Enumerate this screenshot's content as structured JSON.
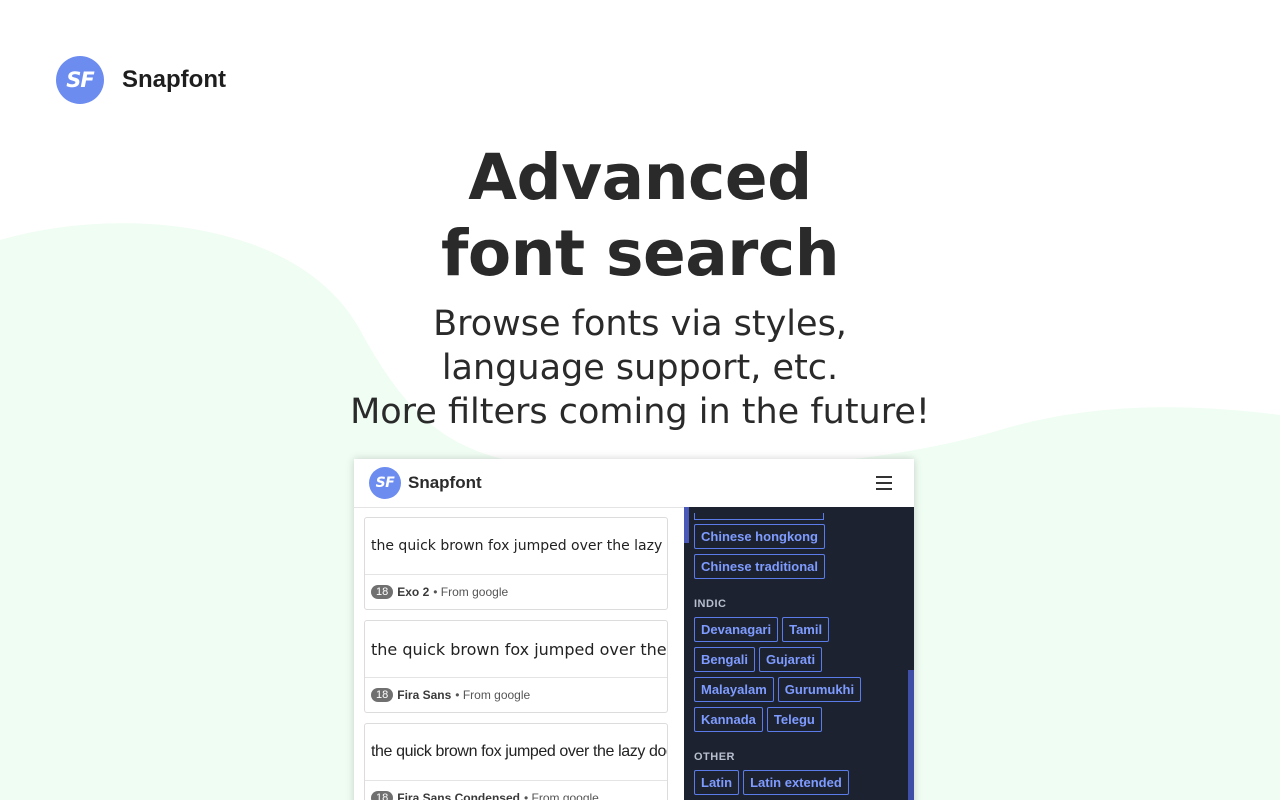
{
  "brand": {
    "logo_text": "SF",
    "name": "Snapfont"
  },
  "hero": {
    "title_line1": "Advanced",
    "title_line2": "font search",
    "sub_line1": "Browse fonts via styles,",
    "sub_line2": "language support, etc.",
    "sub_line3": "More filters coming in the future!"
  },
  "app": {
    "logo_text": "SF",
    "name": "Snapfont",
    "menu_icon": "hamburger-menu-icon",
    "fonts": [
      {
        "sample": "the quick brown fox jumped over the lazy dog",
        "count": "18",
        "name": "Exo 2",
        "source": "• From google"
      },
      {
        "sample": "the quick brown fox jumped over the lazy dog",
        "count": "18",
        "name": "Fira Sans",
        "source": "• From google"
      },
      {
        "sample": "the quick brown fox jumped over the lazy dog",
        "count": "18",
        "name": "Fira Sans Condensed",
        "source": "• From google"
      }
    ],
    "filters": {
      "top_tags": [
        "Chinese hongkong",
        "Chinese traditional"
      ],
      "indic_label": "INDIC",
      "indic_tags": [
        "Devanagari",
        "Tamil",
        "Bengali",
        "Gujarati",
        "Malayalam",
        "Gurumukhi",
        "Kannada",
        "Telegu"
      ],
      "other_label": "OTHER",
      "other_tags": [
        "Latin",
        "Latin extended"
      ]
    }
  },
  "colors": {
    "accent": "#6c8cf0",
    "panel_bg": "#1c2230",
    "tag_border": "#5b7ce8",
    "tag_text": "#7e9bff",
    "wave": "#effdf3"
  }
}
